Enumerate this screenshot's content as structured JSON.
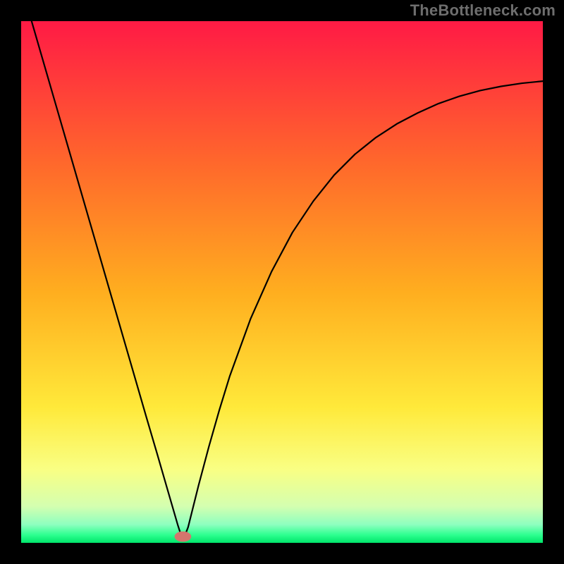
{
  "watermark": "TheBottleneck.com",
  "chart_data": {
    "type": "line",
    "title": "",
    "xlabel": "",
    "ylabel": "",
    "xlim": [
      0,
      100
    ],
    "ylim": [
      0,
      100
    ],
    "grid": false,
    "legend": false,
    "background_gradient": {
      "stops": [
        {
          "offset": 0.0,
          "color": "#ff1a45"
        },
        {
          "offset": 0.28,
          "color": "#ff6a2b"
        },
        {
          "offset": 0.52,
          "color": "#ffae1f"
        },
        {
          "offset": 0.74,
          "color": "#ffe93a"
        },
        {
          "offset": 0.86,
          "color": "#f9ff84"
        },
        {
          "offset": 0.93,
          "color": "#d4ffb0"
        },
        {
          "offset": 0.965,
          "color": "#8dffbf"
        },
        {
          "offset": 0.985,
          "color": "#2cff8f"
        },
        {
          "offset": 1.0,
          "color": "#00e56a"
        }
      ]
    },
    "marker": {
      "x": 31,
      "y": 1.2,
      "rx": 1.6,
      "ry": 1.0,
      "color": "#d4756d"
    },
    "series": [
      {
        "name": "curve",
        "color": "#000000",
        "stroke_width": 2.2,
        "x": [
          2,
          4,
          6,
          8,
          10,
          12,
          14,
          16,
          18,
          20,
          22,
          24,
          26,
          28,
          30,
          31,
          32,
          34,
          36,
          38,
          40,
          44,
          48,
          52,
          56,
          60,
          64,
          68,
          72,
          76,
          80,
          84,
          88,
          92,
          96,
          100
        ],
        "y": [
          100,
          93.1,
          86.2,
          79.3,
          72.4,
          65.5,
          58.6,
          51.7,
          44.8,
          37.9,
          31.0,
          24.1,
          17.3,
          10.4,
          3.5,
          0.4,
          3.0,
          11.0,
          18.5,
          25.5,
          32.0,
          43.0,
          52.0,
          59.5,
          65.5,
          70.5,
          74.5,
          77.7,
          80.3,
          82.4,
          84.2,
          85.6,
          86.7,
          87.5,
          88.1,
          88.5
        ]
      }
    ]
  }
}
